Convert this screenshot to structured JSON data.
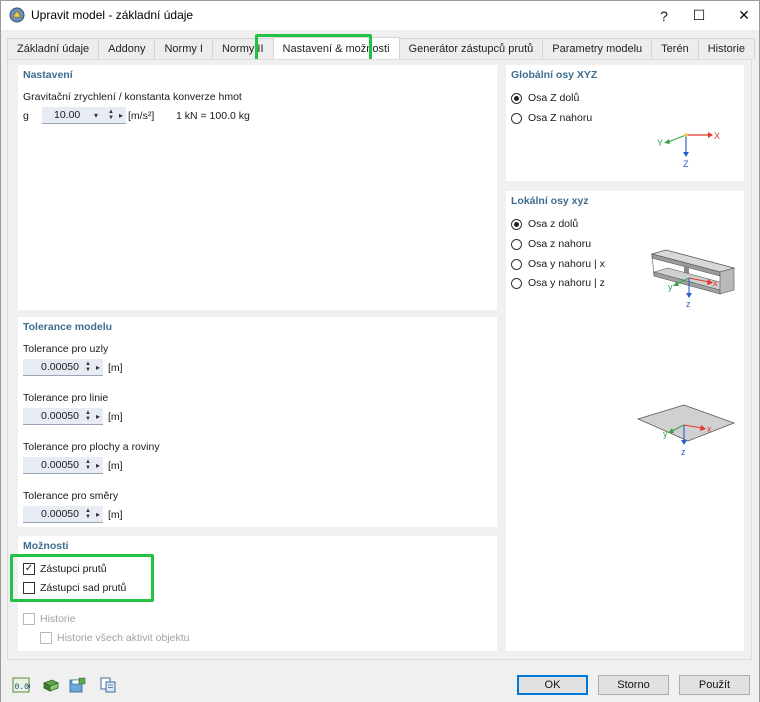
{
  "window": {
    "title": "Upravit model - základní údaje",
    "help": "?",
    "maximize": "☐",
    "close": "✕"
  },
  "tabs": [
    {
      "label": "Základní údaje"
    },
    {
      "label": "Addony"
    },
    {
      "label": "Normy I"
    },
    {
      "label": "Normy II"
    },
    {
      "label": "Nastavení & možnosti",
      "active": true
    },
    {
      "label": "Generátor zástupců prutů"
    },
    {
      "label": "Parametry modelu"
    },
    {
      "label": "Terén"
    },
    {
      "label": "Historie"
    }
  ],
  "settings": {
    "title": "Nastavení",
    "gravity_label": "Gravitační zrychlení / konstanta konverze hmot",
    "g_symbol": "g",
    "g_value": "10.00",
    "g_unit": "[m/s²]",
    "conversion": "1 kN = 100.0 kg"
  },
  "tolerance": {
    "title": "Tolerance modelu",
    "items": [
      {
        "label": "Tolerance pro uzly",
        "value": "0.00050",
        "unit": "[m]"
      },
      {
        "label": "Tolerance pro linie",
        "value": "0.00050",
        "unit": "[m]"
      },
      {
        "label": "Tolerance pro plochy a roviny",
        "value": "0.00050",
        "unit": "[m]"
      },
      {
        "label": "Tolerance pro směry",
        "value": "0.00050",
        "unit": "[m]"
      }
    ]
  },
  "options": {
    "title": "Možnosti",
    "member_reps": {
      "label": "Zástupci prutů",
      "checked": true
    },
    "member_set_reps": {
      "label": "Zástupci sad prutů",
      "checked": false
    },
    "history": {
      "label": "Historie",
      "checked": false,
      "disabled": true
    },
    "history_all": {
      "label": "Historie všech aktivit objektu",
      "checked": false,
      "disabled": true
    }
  },
  "global_axes": {
    "title": "Globální osy XYZ",
    "options": [
      {
        "label": "Osa Z dolů",
        "selected": true
      },
      {
        "label": "Osa Z nahoru",
        "selected": false
      }
    ],
    "axis_labels": {
      "x": "X",
      "y": "Y",
      "z": "Z"
    }
  },
  "local_axes": {
    "title": "Lokální osy xyz",
    "options": [
      {
        "label": "Osa z dolů",
        "selected": true
      },
      {
        "label": "Osa z nahoru",
        "selected": false
      },
      {
        "label": "Osa y nahoru | x",
        "selected": false
      },
      {
        "label": "Osa y nahoru | z",
        "selected": false
      }
    ],
    "axis_labels": {
      "x": "x",
      "y": "y",
      "z": "z"
    }
  },
  "buttons": {
    "ok": "OK",
    "cancel": "Storno",
    "apply": "Použít"
  },
  "toolbar_icons": [
    "units-icon",
    "model-icon",
    "save-settings-icon",
    "copy-icon"
  ],
  "colors": {
    "highlight": "#22c244",
    "x_axis": "#e0362c",
    "y_axis": "#3aa34a",
    "z_axis": "#2b5fc9",
    "section_title": "#3d6d8f"
  }
}
